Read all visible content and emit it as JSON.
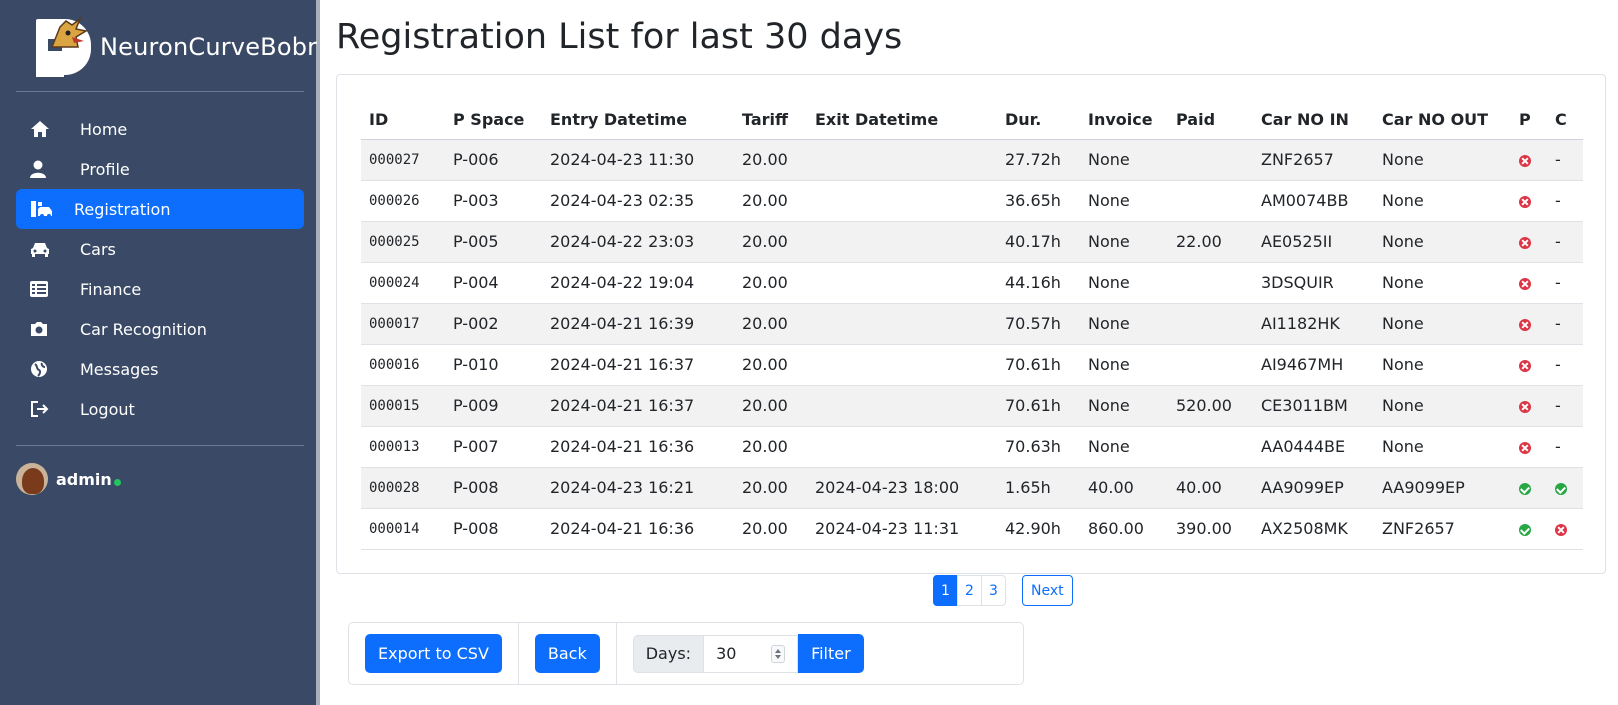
{
  "sidebar": {
    "brand": "NeuronCurveBobr",
    "items": [
      {
        "label": "Home",
        "icon": "home-icon"
      },
      {
        "label": "Profile",
        "icon": "user-icon"
      },
      {
        "label": "Registration",
        "icon": "registration-icon",
        "active": true
      },
      {
        "label": "Cars",
        "icon": "car-icon"
      },
      {
        "label": "Finance",
        "icon": "list-icon"
      },
      {
        "label": "Car Recognition",
        "icon": "camera-icon"
      },
      {
        "label": "Messages",
        "icon": "globe-icon"
      },
      {
        "label": "Logout",
        "icon": "logout-icon"
      }
    ],
    "user": "admin"
  },
  "page": {
    "title": "Registration List for last 30 days"
  },
  "table": {
    "headers": [
      "ID",
      "P Space",
      "Entry Datetime",
      "Tariff",
      "Exit Datetime",
      "Dur.",
      "Invoice",
      "Paid",
      "Car NO IN",
      "Car NO OUT",
      "P",
      "C"
    ],
    "rows": [
      {
        "id": "000027",
        "space": "P-006",
        "entry": "2024-04-23 11:30",
        "tariff": "20.00",
        "exit": "",
        "dur": "27.72h",
        "invoice": "None",
        "paid": "",
        "car_in": "ZNF2657",
        "car_out": "None",
        "p": "no",
        "c": "-"
      },
      {
        "id": "000026",
        "space": "P-003",
        "entry": "2024-04-23 02:35",
        "tariff": "20.00",
        "exit": "",
        "dur": "36.65h",
        "invoice": "None",
        "paid": "",
        "car_in": "AM0074BB",
        "car_out": "None",
        "p": "no",
        "c": "-"
      },
      {
        "id": "000025",
        "space": "P-005",
        "entry": "2024-04-22 23:03",
        "tariff": "20.00",
        "exit": "",
        "dur": "40.17h",
        "invoice": "None",
        "paid": "22.00",
        "car_in": "AE0525II",
        "car_out": "None",
        "p": "no",
        "c": "-"
      },
      {
        "id": "000024",
        "space": "P-004",
        "entry": "2024-04-22 19:04",
        "tariff": "20.00",
        "exit": "",
        "dur": "44.16h",
        "invoice": "None",
        "paid": "",
        "car_in": "3DSQUIR",
        "car_out": "None",
        "p": "no",
        "c": "-"
      },
      {
        "id": "000017",
        "space": "P-002",
        "entry": "2024-04-21 16:39",
        "tariff": "20.00",
        "exit": "",
        "dur": "70.57h",
        "invoice": "None",
        "paid": "",
        "car_in": "AI1182HK",
        "car_out": "None",
        "p": "no",
        "c": "-"
      },
      {
        "id": "000016",
        "space": "P-010",
        "entry": "2024-04-21 16:37",
        "tariff": "20.00",
        "exit": "",
        "dur": "70.61h",
        "invoice": "None",
        "paid": "",
        "car_in": "AI9467MH",
        "car_out": "None",
        "p": "no",
        "c": "-"
      },
      {
        "id": "000015",
        "space": "P-009",
        "entry": "2024-04-21 16:37",
        "tariff": "20.00",
        "exit": "",
        "dur": "70.61h",
        "invoice": "None",
        "paid": "520.00",
        "car_in": "CE3011BM",
        "car_out": "None",
        "p": "no",
        "c": "-"
      },
      {
        "id": "000013",
        "space": "P-007",
        "entry": "2024-04-21 16:36",
        "tariff": "20.00",
        "exit": "",
        "dur": "70.63h",
        "invoice": "None",
        "paid": "",
        "car_in": "AA0444BE",
        "car_out": "None",
        "p": "no",
        "c": "-"
      },
      {
        "id": "000028",
        "space": "P-008",
        "entry": "2024-04-23 16:21",
        "tariff": "20.00",
        "exit": "2024-04-23 18:00",
        "dur": "1.65h",
        "invoice": "40.00",
        "paid": "40.00",
        "car_in": "AA9099EP",
        "car_out": "AA9099EP",
        "p": "yes",
        "c": "yes"
      },
      {
        "id": "000014",
        "space": "P-008",
        "entry": "2024-04-21 16:36",
        "tariff": "20.00",
        "exit": "2024-04-23 11:31",
        "dur": "42.90h",
        "invoice": "860.00",
        "paid": "390.00",
        "car_in": "AX2508MK",
        "car_out": "ZNF2657",
        "p": "yes",
        "c": "no"
      }
    ]
  },
  "pagination": {
    "pages": [
      "1",
      "2",
      "3"
    ],
    "current": "1",
    "next": "Next"
  },
  "controls": {
    "export_label": "Export to CSV",
    "back_label": "Back",
    "days_label": "Days:",
    "days_value": "30",
    "filter_label": "Filter"
  },
  "colors": {
    "sidebar_bg": "#3a4a66",
    "accent": "#0d6efd",
    "danger": "#dc3545",
    "success": "#28a745"
  }
}
